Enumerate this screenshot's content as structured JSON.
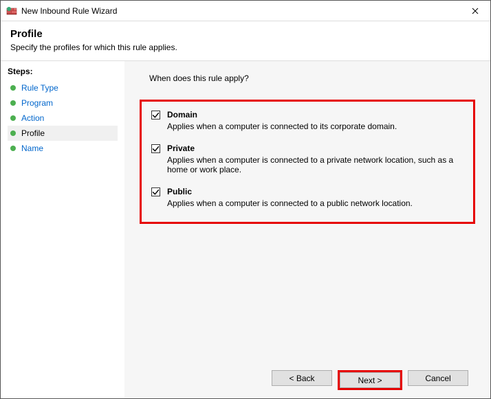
{
  "window": {
    "title": "New Inbound Rule Wizard"
  },
  "header": {
    "title": "Profile",
    "subtitle": "Specify the profiles for which this rule applies."
  },
  "sidebar": {
    "title": "Steps:",
    "items": [
      {
        "label": "Rule Type",
        "active": false
      },
      {
        "label": "Program",
        "active": false
      },
      {
        "label": "Action",
        "active": false
      },
      {
        "label": "Profile",
        "active": true
      },
      {
        "label": "Name",
        "active": false
      }
    ]
  },
  "main": {
    "question": "When does this rule apply?",
    "profiles": [
      {
        "label": "Domain",
        "checked": true,
        "desc": "Applies when a computer is connected to its corporate domain."
      },
      {
        "label": "Private",
        "checked": true,
        "desc": "Applies when a computer is connected to a private network location, such as a home or work place."
      },
      {
        "label": "Public",
        "checked": true,
        "desc": "Applies when a computer is connected to a public network location."
      }
    ]
  },
  "buttons": {
    "back": "< Back",
    "next": "Next >",
    "cancel": "Cancel"
  }
}
